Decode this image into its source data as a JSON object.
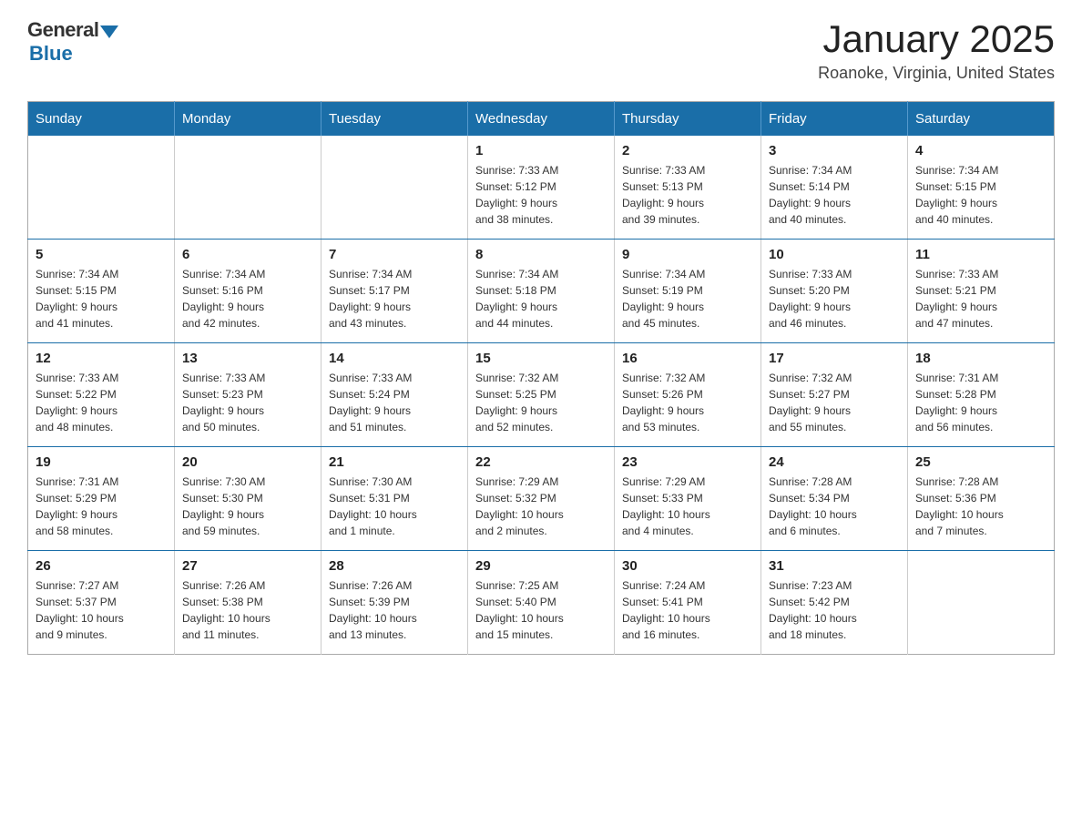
{
  "logo": {
    "general": "General",
    "blue": "Blue",
    "arrow": "triangle-down"
  },
  "header": {
    "title": "January 2025",
    "location": "Roanoke, Virginia, United States"
  },
  "days_of_week": [
    "Sunday",
    "Monday",
    "Tuesday",
    "Wednesday",
    "Thursday",
    "Friday",
    "Saturday"
  ],
  "weeks": [
    [
      {
        "day": "",
        "info": ""
      },
      {
        "day": "",
        "info": ""
      },
      {
        "day": "",
        "info": ""
      },
      {
        "day": "1",
        "info": "Sunrise: 7:33 AM\nSunset: 5:12 PM\nDaylight: 9 hours\nand 38 minutes."
      },
      {
        "day": "2",
        "info": "Sunrise: 7:33 AM\nSunset: 5:13 PM\nDaylight: 9 hours\nand 39 minutes."
      },
      {
        "day": "3",
        "info": "Sunrise: 7:34 AM\nSunset: 5:14 PM\nDaylight: 9 hours\nand 40 minutes."
      },
      {
        "day": "4",
        "info": "Sunrise: 7:34 AM\nSunset: 5:15 PM\nDaylight: 9 hours\nand 40 minutes."
      }
    ],
    [
      {
        "day": "5",
        "info": "Sunrise: 7:34 AM\nSunset: 5:15 PM\nDaylight: 9 hours\nand 41 minutes."
      },
      {
        "day": "6",
        "info": "Sunrise: 7:34 AM\nSunset: 5:16 PM\nDaylight: 9 hours\nand 42 minutes."
      },
      {
        "day": "7",
        "info": "Sunrise: 7:34 AM\nSunset: 5:17 PM\nDaylight: 9 hours\nand 43 minutes."
      },
      {
        "day": "8",
        "info": "Sunrise: 7:34 AM\nSunset: 5:18 PM\nDaylight: 9 hours\nand 44 minutes."
      },
      {
        "day": "9",
        "info": "Sunrise: 7:34 AM\nSunset: 5:19 PM\nDaylight: 9 hours\nand 45 minutes."
      },
      {
        "day": "10",
        "info": "Sunrise: 7:33 AM\nSunset: 5:20 PM\nDaylight: 9 hours\nand 46 minutes."
      },
      {
        "day": "11",
        "info": "Sunrise: 7:33 AM\nSunset: 5:21 PM\nDaylight: 9 hours\nand 47 minutes."
      }
    ],
    [
      {
        "day": "12",
        "info": "Sunrise: 7:33 AM\nSunset: 5:22 PM\nDaylight: 9 hours\nand 48 minutes."
      },
      {
        "day": "13",
        "info": "Sunrise: 7:33 AM\nSunset: 5:23 PM\nDaylight: 9 hours\nand 50 minutes."
      },
      {
        "day": "14",
        "info": "Sunrise: 7:33 AM\nSunset: 5:24 PM\nDaylight: 9 hours\nand 51 minutes."
      },
      {
        "day": "15",
        "info": "Sunrise: 7:32 AM\nSunset: 5:25 PM\nDaylight: 9 hours\nand 52 minutes."
      },
      {
        "day": "16",
        "info": "Sunrise: 7:32 AM\nSunset: 5:26 PM\nDaylight: 9 hours\nand 53 minutes."
      },
      {
        "day": "17",
        "info": "Sunrise: 7:32 AM\nSunset: 5:27 PM\nDaylight: 9 hours\nand 55 minutes."
      },
      {
        "day": "18",
        "info": "Sunrise: 7:31 AM\nSunset: 5:28 PM\nDaylight: 9 hours\nand 56 minutes."
      }
    ],
    [
      {
        "day": "19",
        "info": "Sunrise: 7:31 AM\nSunset: 5:29 PM\nDaylight: 9 hours\nand 58 minutes."
      },
      {
        "day": "20",
        "info": "Sunrise: 7:30 AM\nSunset: 5:30 PM\nDaylight: 9 hours\nand 59 minutes."
      },
      {
        "day": "21",
        "info": "Sunrise: 7:30 AM\nSunset: 5:31 PM\nDaylight: 10 hours\nand 1 minute."
      },
      {
        "day": "22",
        "info": "Sunrise: 7:29 AM\nSunset: 5:32 PM\nDaylight: 10 hours\nand 2 minutes."
      },
      {
        "day": "23",
        "info": "Sunrise: 7:29 AM\nSunset: 5:33 PM\nDaylight: 10 hours\nand 4 minutes."
      },
      {
        "day": "24",
        "info": "Sunrise: 7:28 AM\nSunset: 5:34 PM\nDaylight: 10 hours\nand 6 minutes."
      },
      {
        "day": "25",
        "info": "Sunrise: 7:28 AM\nSunset: 5:36 PM\nDaylight: 10 hours\nand 7 minutes."
      }
    ],
    [
      {
        "day": "26",
        "info": "Sunrise: 7:27 AM\nSunset: 5:37 PM\nDaylight: 10 hours\nand 9 minutes."
      },
      {
        "day": "27",
        "info": "Sunrise: 7:26 AM\nSunset: 5:38 PM\nDaylight: 10 hours\nand 11 minutes."
      },
      {
        "day": "28",
        "info": "Sunrise: 7:26 AM\nSunset: 5:39 PM\nDaylight: 10 hours\nand 13 minutes."
      },
      {
        "day": "29",
        "info": "Sunrise: 7:25 AM\nSunset: 5:40 PM\nDaylight: 10 hours\nand 15 minutes."
      },
      {
        "day": "30",
        "info": "Sunrise: 7:24 AM\nSunset: 5:41 PM\nDaylight: 10 hours\nand 16 minutes."
      },
      {
        "day": "31",
        "info": "Sunrise: 7:23 AM\nSunset: 5:42 PM\nDaylight: 10 hours\nand 18 minutes."
      },
      {
        "day": "",
        "info": ""
      }
    ]
  ]
}
